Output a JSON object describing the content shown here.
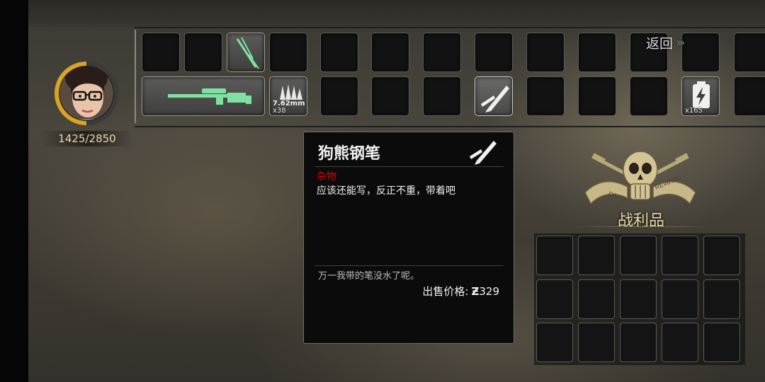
{
  "character": {
    "hp_text": "1425/2850",
    "hp_fraction": 0.5
  },
  "nav": {
    "back_label": "返回",
    "back_chevrons": "›››"
  },
  "inventory": {
    "ammo_label": "7.62mm",
    "ammo_quantity": "x38",
    "battery_quantity": "x165"
  },
  "item_tooltip": {
    "name": "狗熊钢笔",
    "category": "杂物",
    "description": "应该还能写，反正不重，带着吧",
    "flavor_text": "万一我带的笔没水了呢。",
    "price_label": "出售价格:",
    "price_symbol": "Ƶ",
    "price_value": "329"
  },
  "loot": {
    "title": "战利品",
    "emblem_text": "DEAD REWARD"
  },
  "colors": {
    "category_red": "#e00000",
    "gold": "#e6d8a6",
    "hp_ring": "#d9a520",
    "sniper_green": "#7fe0a0"
  }
}
